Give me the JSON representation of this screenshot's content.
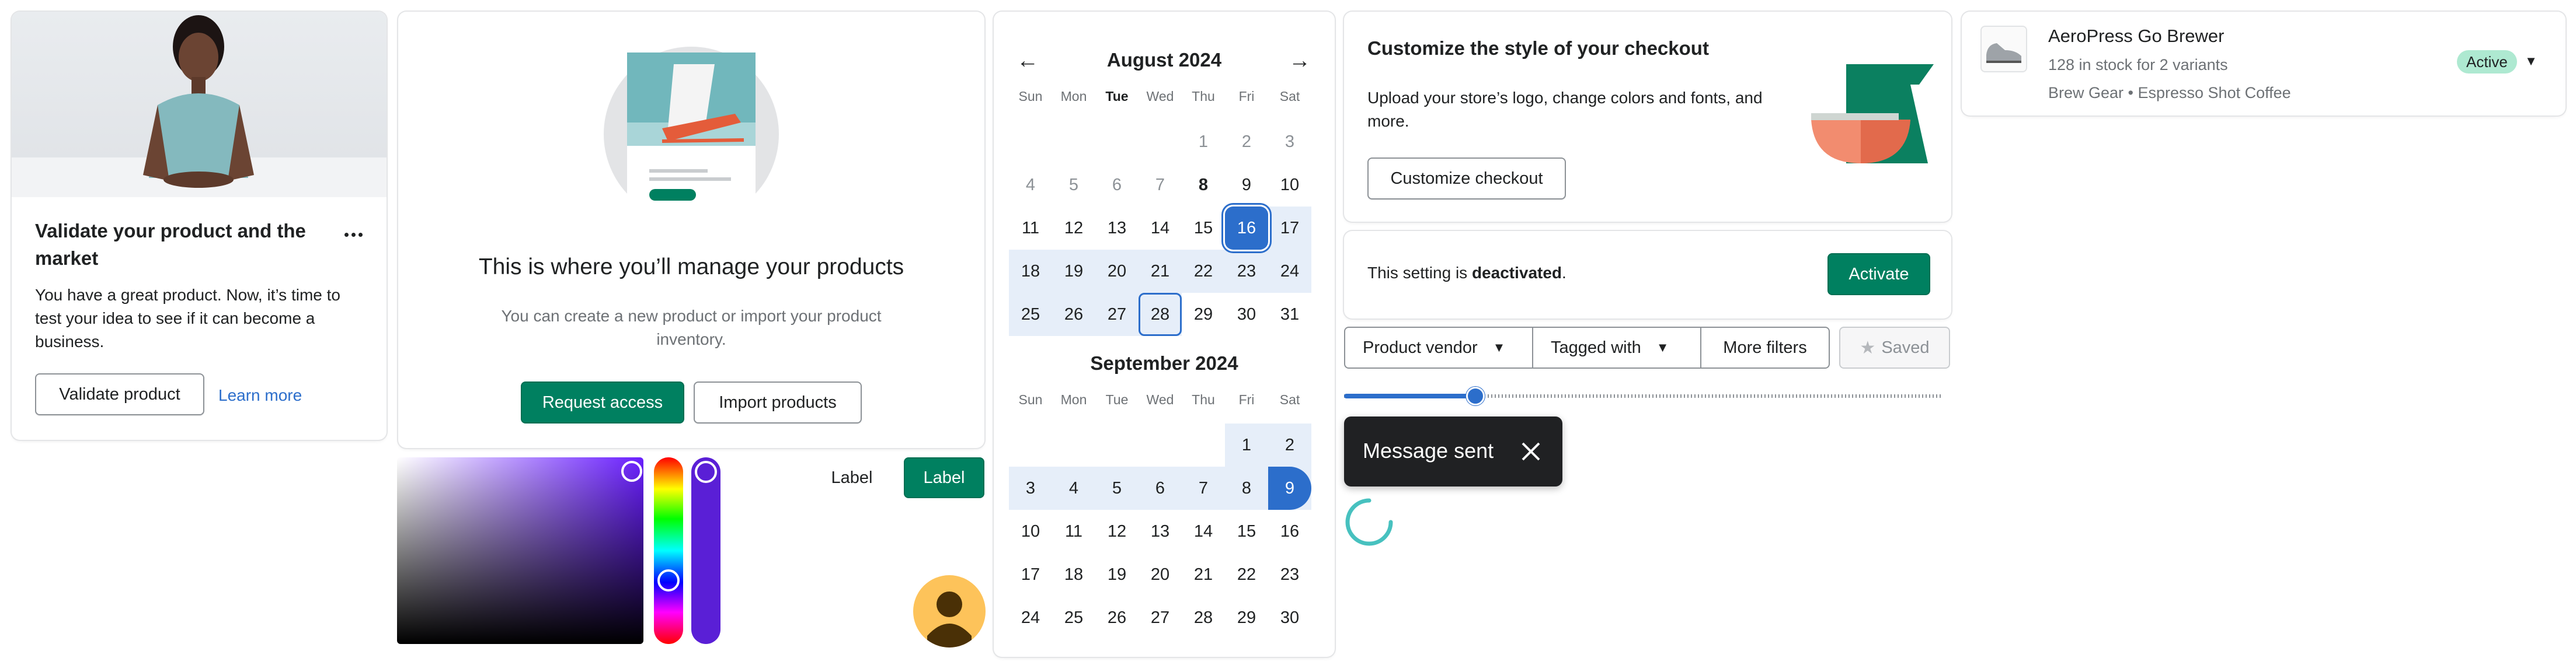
{
  "product_card": {
    "title": "Validate your product and the market",
    "body": "You have a great product. Now, it’s time to test your idea to see if it can become a business.",
    "primary_action": "Validate product",
    "secondary_action": "Learn more"
  },
  "empty_state": {
    "heading": "This is where you’ll manage your products",
    "body": "You can create a new product or import your product inventory.",
    "primary_action": "Request access",
    "secondary_action": "Import products"
  },
  "label_buttons": {
    "plain": "Label",
    "primary": "Label"
  },
  "calendar": {
    "weekdays": [
      "Sun",
      "Mon",
      "Tue",
      "Wed",
      "Thu",
      "Fri",
      "Sat"
    ],
    "months": [
      {
        "title": "August 2024"
      },
      {
        "title": "September 2024"
      }
    ]
  },
  "checkout_card": {
    "title": "Customize the style of your checkout",
    "body": "Upload your store’s logo, change colors and fonts, and more.",
    "action": "Customize checkout"
  },
  "setting_toggle": {
    "text_before": "This setting is ",
    "status": "deactivated",
    "text_after": ".",
    "action": "Activate"
  },
  "filters": {
    "product_vendor": "Product vendor",
    "tagged_with": "Tagged with",
    "more_filters": "More filters",
    "saved": "Saved"
  },
  "slider": {
    "value_fraction": 0.22
  },
  "toast": {
    "message": "Message sent"
  },
  "product_row": {
    "name": "AeroPress Go Brewer",
    "stock": "128 in stock for 2 variants",
    "tags": "Brew Gear • Espresso Shot Coffee",
    "status": "Active"
  },
  "colors": {
    "primary": "#008060",
    "accent_blue": "#2c6ecb",
    "picked_color": "#5a1fd6",
    "avatar": "#fdc35a",
    "badge_bg": "#aee9d1"
  }
}
